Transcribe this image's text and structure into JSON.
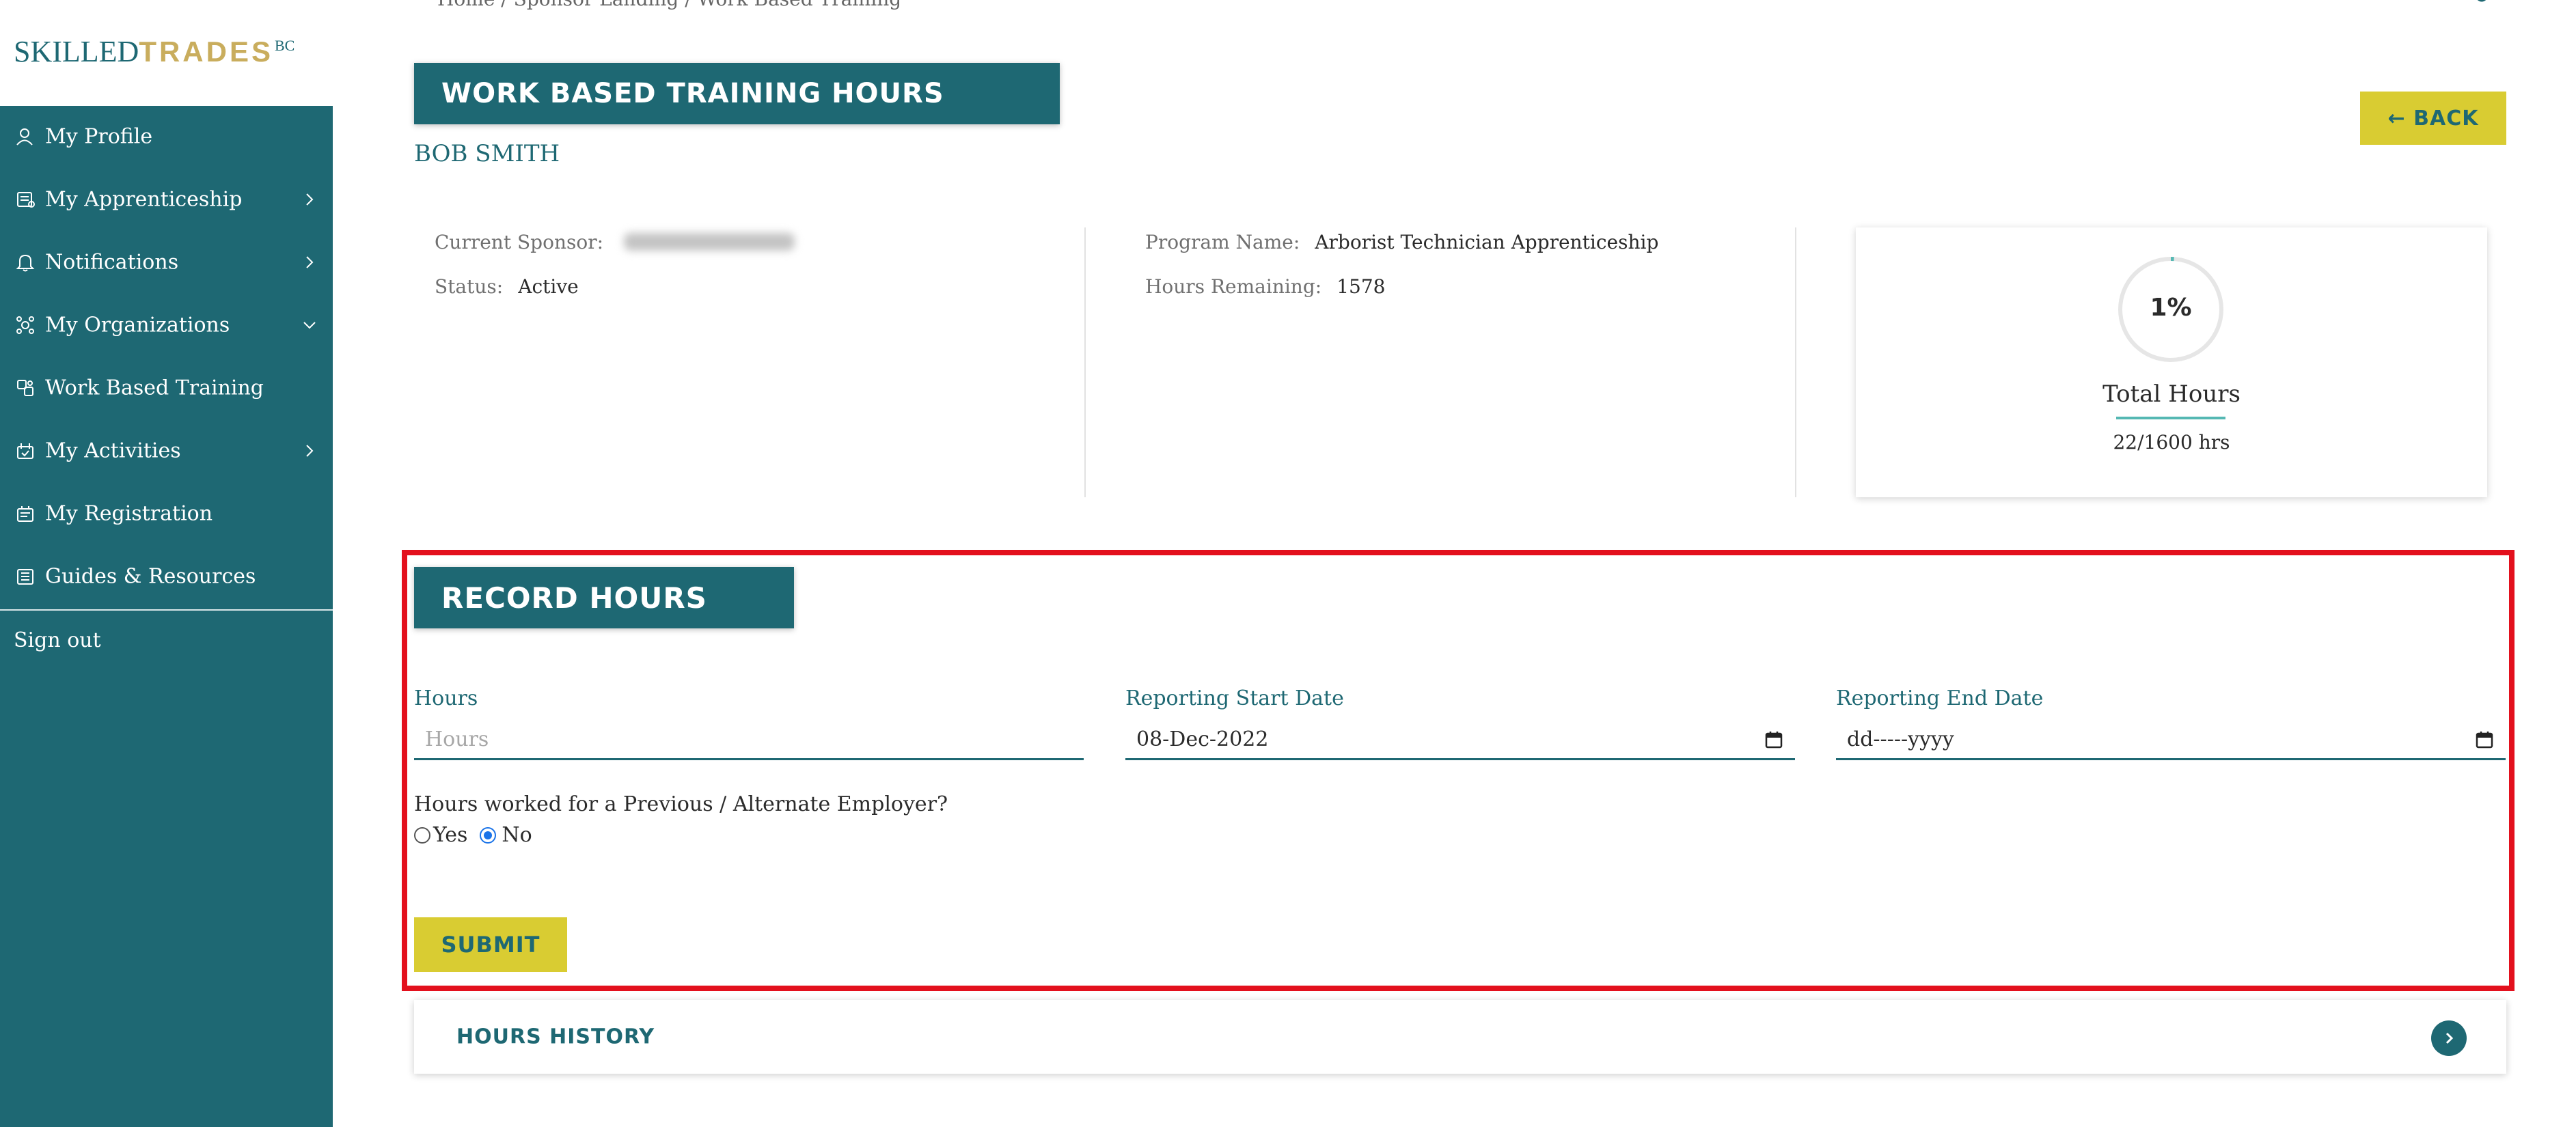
{
  "logo": {
    "part1": "SKILLED",
    "part2": "TRADES",
    "suffix": "BC"
  },
  "breadcrumb": {
    "text": "Home  /  Sponsor Landing  /  Work Based Training"
  },
  "sidebar": {
    "items": [
      {
        "label": "My Profile",
        "icon": "person-icon",
        "has_chevron": false
      },
      {
        "label": "My Apprenticeship",
        "icon": "apprenticeship-icon",
        "has_chevron": true
      },
      {
        "label": "Notifications",
        "icon": "bell-icon",
        "has_chevron": true
      },
      {
        "label": "My Organizations",
        "icon": "organizations-icon",
        "has_chevron": true,
        "expanded": true
      },
      {
        "label": "Work Based Training",
        "icon": "training-icon",
        "has_chevron": false
      },
      {
        "label": "My Activities",
        "icon": "activities-icon",
        "has_chevron": true
      },
      {
        "label": "My Registration",
        "icon": "registration-icon",
        "has_chevron": false
      },
      {
        "label": "Guides & Resources",
        "icon": "guides-icon",
        "has_chevron": false
      }
    ],
    "signout": "Sign out"
  },
  "page": {
    "title": "WORK BASED TRAINING HOURS",
    "person_name": "BOB SMITH",
    "back_label": "← BACK"
  },
  "info": {
    "current_sponsor_label": "Current Sponsor:",
    "status_label": "Status:",
    "status_value": "Active",
    "program_label": "Program Name:",
    "program_value": "Arborist Technician Apprenticeship",
    "remaining_label": "Hours Remaining:",
    "remaining_value": "1578"
  },
  "total_hours": {
    "percent_text": "1%",
    "percent_value": 0.01,
    "title": "Total Hours",
    "value_text": "22/1600 hrs"
  },
  "record": {
    "title": "RECORD HOURS",
    "hours_label": "Hours",
    "hours_placeholder": "Hours",
    "start_label": "Reporting Start Date",
    "start_value": "08-Dec-2022",
    "end_label": "Reporting End Date",
    "end_value": "dd-----yyyy",
    "question": "Hours worked for a Previous / Alternate Employer?",
    "yes_label": "Yes",
    "no_label": "No",
    "selected": "No",
    "submit_label": "SUBMIT"
  },
  "history": {
    "label": "HOURS HISTORY"
  },
  "colors": {
    "brand_teal": "#1e6873",
    "accent_yellow": "#d9cc32",
    "logo_gold": "#c9ad5d",
    "highlight_red": "#e3101d",
    "progress_teal": "#55b8b3"
  }
}
